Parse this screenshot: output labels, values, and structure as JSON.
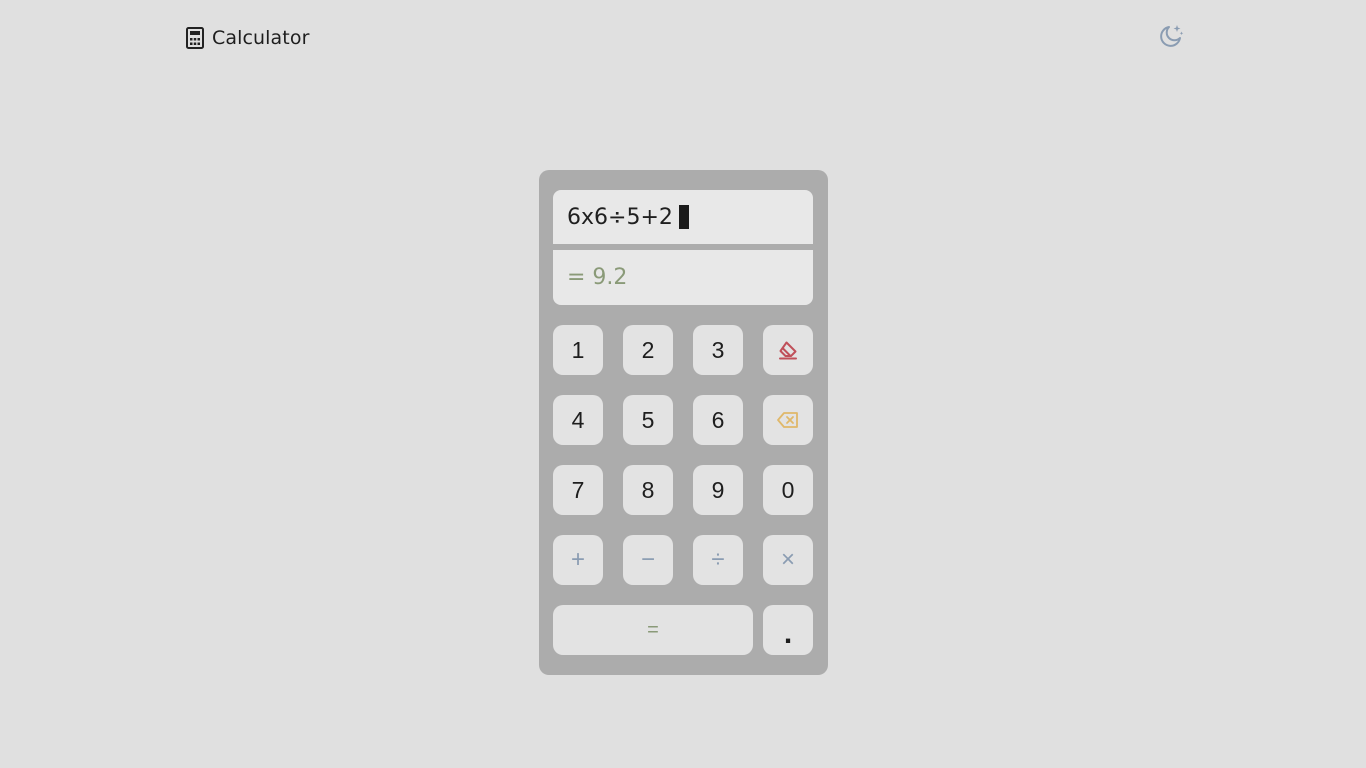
{
  "header": {
    "title": "Calculator",
    "logo_icon": "calculator-icon",
    "theme_toggle_icon": "moon-stars-icon"
  },
  "display": {
    "expression": "6x6÷5+2",
    "result": "= 9.2"
  },
  "keypad": {
    "digits": {
      "one": "1",
      "two": "2",
      "three": "3",
      "four": "4",
      "five": "5",
      "six": "6",
      "seven": "7",
      "eight": "8",
      "nine": "9",
      "zero": "0"
    },
    "operators": {
      "plus": "+",
      "minus": "−",
      "divide": "÷",
      "multiply": "×"
    },
    "equals": "=",
    "decimal": ".",
    "clear_icon": "eraser-icon",
    "backspace_icon": "backspace-icon"
  },
  "colors": {
    "background": "#e0e0e0",
    "calculator_body": "#acacac",
    "key": "#e3e3e3",
    "result_text": "#8a9a78",
    "operator_text": "#8a9cb2",
    "clear_accent": "#c0505a",
    "backspace_accent": "#e0b86a",
    "theme_icon": "#8a9cb2"
  }
}
